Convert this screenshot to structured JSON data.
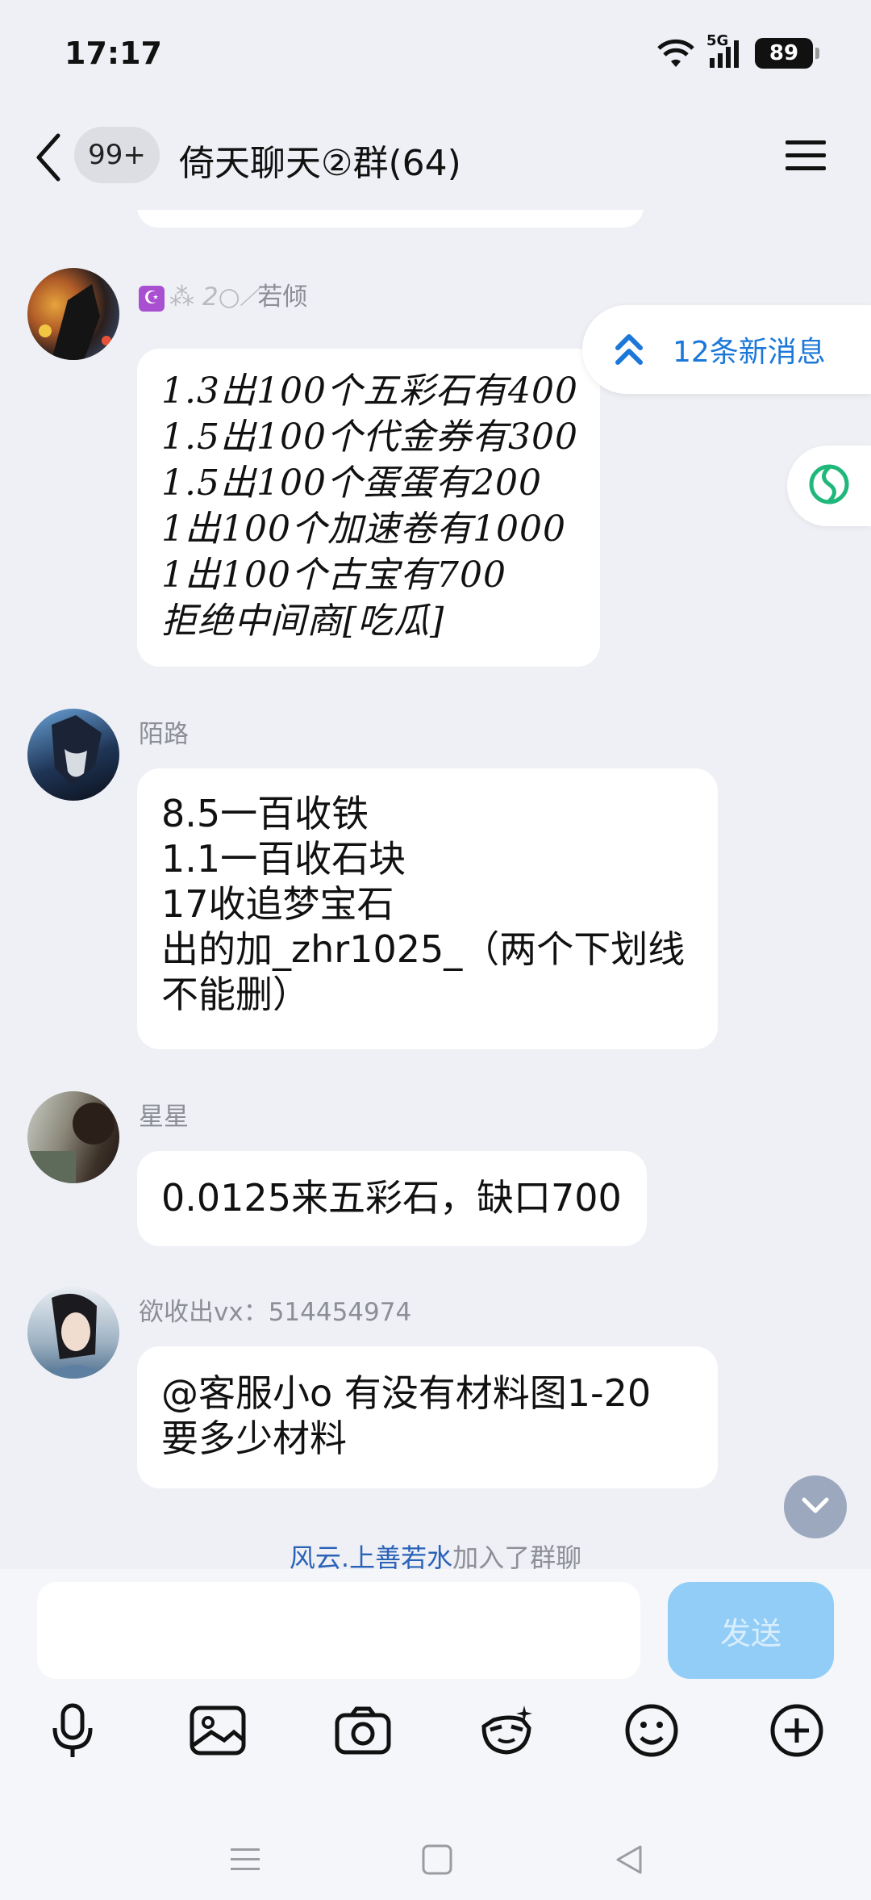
{
  "status_bar": {
    "time": "17:17",
    "network": "5G",
    "battery": "89"
  },
  "header": {
    "unread_count": "99+",
    "title": "倚天聊天②群(64)"
  },
  "new_messages": {
    "label": "12条新消息"
  },
  "messages": [
    {
      "sender": "若倾",
      "lines": [
        "1.3出100个五彩石有400",
        "1.5出100个代金券有300",
        "1.5出100个蛋蛋有200",
        "1出100个加速卷有1000",
        "1出100个古宝有700",
        "拒绝中间商[吃瓜]"
      ]
    },
    {
      "sender": "陌路",
      "lines": [
        "8.5一百收铁",
        "1.1一百收石块",
        "17收追梦宝石",
        "出的加_zhr1025_（两个下划线",
        "不能删）"
      ]
    },
    {
      "sender": "星星",
      "lines": [
        "0.0125来五彩石，缺口700"
      ]
    },
    {
      "sender": "欲收出vx：514454974",
      "lines": [
        "@客服小o 有没有材料图1-20",
        "要多少材料"
      ]
    }
  ],
  "system_notice": {
    "who": "风云.上善若水",
    "action": "加入了群聊"
  },
  "input": {
    "placeholder": "",
    "send_label": "发送"
  },
  "toolbar": {
    "icons": [
      "mic-icon",
      "image-icon",
      "camera-icon",
      "sticker-icon",
      "emoji-icon",
      "plus-icon"
    ]
  },
  "colors": {
    "accent": "#1b78d8",
    "send_disabled": "#91cdf7",
    "background": "#eef0f5"
  }
}
